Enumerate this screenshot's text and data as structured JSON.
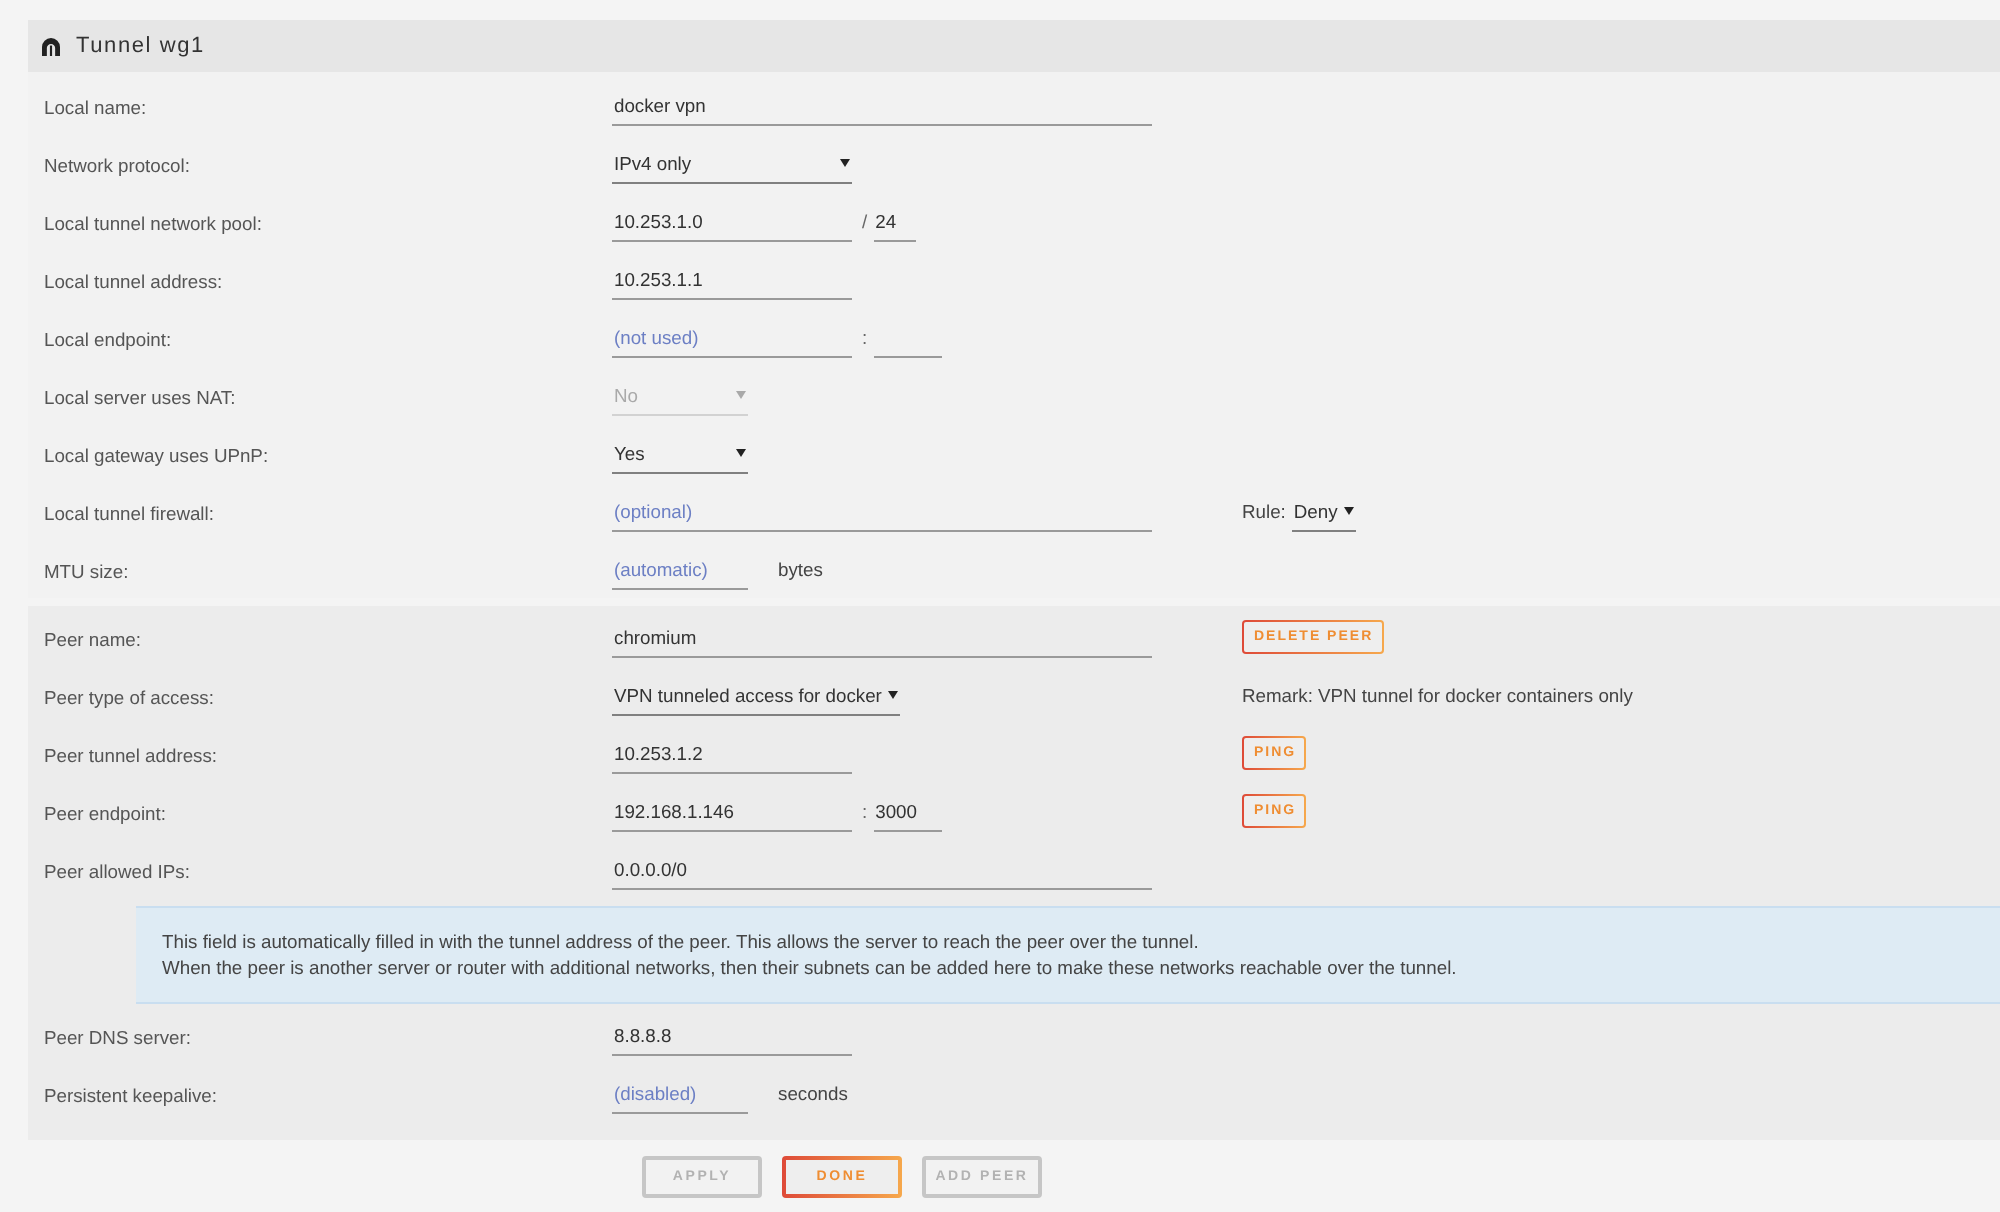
{
  "panel": {
    "title": "Tunnel wg1"
  },
  "local_settings": [
    {
      "label": "Local name:",
      "controls": [
        {
          "kind": "text-input",
          "value": "docker vpn"
        }
      ]
    },
    {
      "label": "Network protocol:",
      "controls": [
        {
          "kind": "protocol-select",
          "value": "IPv4 only",
          "disabled": false
        }
      ]
    },
    {
      "label": "Local tunnel network pool:",
      "controls": [
        {
          "kind": "ip-input",
          "value": "10.253.1.0"
        },
        {
          "kind": "separator",
          "text": "/"
        },
        {
          "kind": "prefix-input",
          "value": "24"
        }
      ]
    },
    {
      "label": "Local tunnel address:",
      "controls": [
        {
          "kind": "ip-input",
          "value": "10.253.1.1"
        }
      ]
    },
    {
      "label": "Local endpoint:",
      "controls": [
        {
          "kind": "ip-input",
          "placeholder": "(not used)"
        },
        {
          "kind": "separator",
          "text": ":"
        },
        {
          "kind": "port-input"
        }
      ]
    },
    {
      "label": "Local server uses NAT:",
      "controls": [
        {
          "kind": "switch-select",
          "value": "No",
          "disabled": true
        }
      ]
    },
    {
      "label": "Local gateway uses UPnP:",
      "controls": [
        {
          "kind": "switch-select",
          "value": "Yes",
          "disabled": false
        }
      ]
    },
    {
      "label": "Local tunnel firewall:",
      "controls": [
        {
          "kind": "text-input",
          "placeholder": "(optional)"
        }
      ],
      "aside": [
        {
          "kind": "label",
          "text": "Rule:"
        },
        {
          "kind": "rule-select",
          "value": "Deny",
          "disabled": false
        }
      ]
    },
    {
      "label": "MTU size:",
      "controls": [
        {
          "kind": "number-input",
          "placeholder": "(automatic)"
        },
        {
          "kind": "unit",
          "text": "bytes"
        }
      ]
    }
  ],
  "peer": {
    "settings": [
      {
        "label": "Peer name:",
        "controls": [
          {
            "kind": "text-input",
            "value": "chromium"
          }
        ],
        "aside": [
          {
            "kind": "button",
            "label": "DELETE PEER",
            "disabled": false
          }
        ]
      },
      {
        "label": "Peer type of access:",
        "controls": [
          {
            "kind": "access-select",
            "value": "VPN tunneled access for docker",
            "disabled": false
          }
        ],
        "aside": [
          {
            "kind": "remark",
            "text": "Remark: VPN tunnel for docker containers only"
          }
        ]
      },
      {
        "label": "Peer tunnel address:",
        "controls": [
          {
            "kind": "ip-input",
            "value": "10.253.1.2"
          }
        ],
        "aside": [
          {
            "kind": "button",
            "label": "PING",
            "disabled": false
          }
        ]
      },
      {
        "label": "Peer endpoint:",
        "controls": [
          {
            "kind": "ip-input",
            "value": "192.168.1.146"
          },
          {
            "kind": "separator",
            "text": ":"
          },
          {
            "kind": "port-input",
            "value": "3000"
          }
        ],
        "aside": [
          {
            "kind": "button",
            "label": "PING",
            "disabled": false
          }
        ]
      },
      {
        "label": "Peer allowed IPs:",
        "controls": [
          {
            "kind": "text-input",
            "value": "0.0.0.0/0"
          }
        ]
      }
    ],
    "info": [
      "This field is automatically filled in with the tunnel address of the peer. This allows the server to reach the peer over the tunnel.",
      "When the peer is another server or router with additional networks, then their subnets can be added here to make these networks reachable over the tunnel."
    ],
    "more_settings": [
      {
        "label": "Peer DNS server:",
        "controls": [
          {
            "kind": "ip-input",
            "value": "8.8.8.8"
          }
        ]
      },
      {
        "label": "Persistent keepalive:",
        "controls": [
          {
            "kind": "number-input",
            "placeholder": "(disabled)"
          },
          {
            "kind": "unit",
            "text": "seconds"
          }
        ]
      }
    ]
  },
  "buttons": [
    {
      "label": "APPLY",
      "disabled": true
    },
    {
      "label": "DONE",
      "disabled": false
    },
    {
      "label": "ADD PEER",
      "disabled": true
    }
  ]
}
